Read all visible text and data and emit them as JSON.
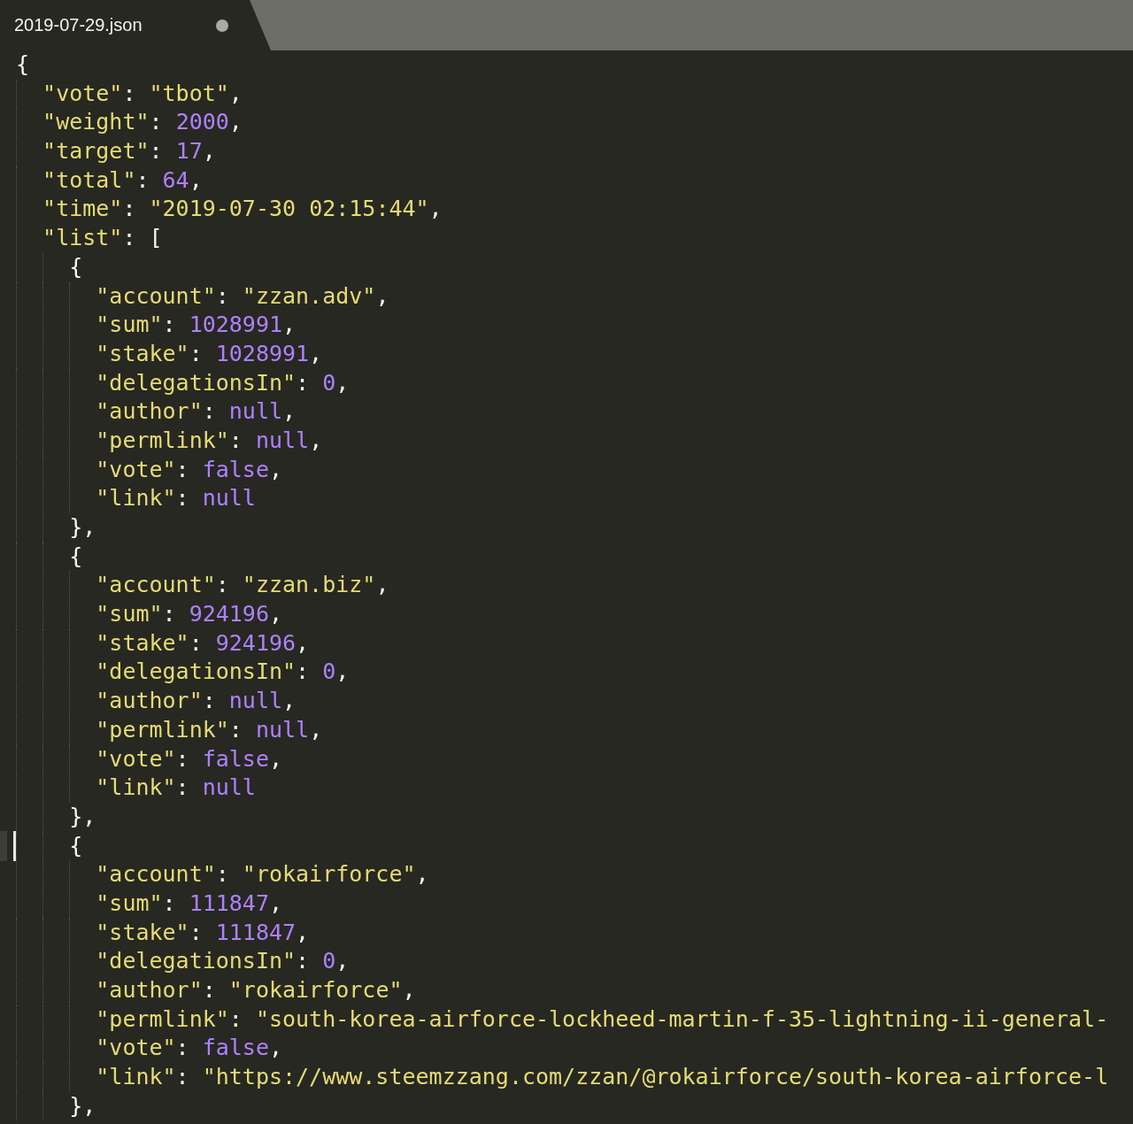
{
  "tab": {
    "title": "2019-07-29.json",
    "modified": true
  },
  "code": [
    {
      "tokens": [
        {
          "kind": "punct",
          "text": "{"
        }
      ],
      "children": [
        {
          "tokens": [
            {
              "kind": "key",
              "text": "\"vote\""
            },
            {
              "kind": "punct",
              "text": ": "
            },
            {
              "kind": "string",
              "text": "\"tbot\""
            },
            {
              "kind": "punct",
              "text": ","
            }
          ]
        },
        {
          "tokens": [
            {
              "kind": "key",
              "text": "\"weight\""
            },
            {
              "kind": "punct",
              "text": ": "
            },
            {
              "kind": "number",
              "text": "2000"
            },
            {
              "kind": "punct",
              "text": ","
            }
          ]
        },
        {
          "tokens": [
            {
              "kind": "key",
              "text": "\"target\""
            },
            {
              "kind": "punct",
              "text": ": "
            },
            {
              "kind": "number",
              "text": "17"
            },
            {
              "kind": "punct",
              "text": ","
            }
          ]
        },
        {
          "tokens": [
            {
              "kind": "key",
              "text": "\"total\""
            },
            {
              "kind": "punct",
              "text": ": "
            },
            {
              "kind": "number",
              "text": "64"
            },
            {
              "kind": "punct",
              "text": ","
            }
          ]
        },
        {
          "tokens": [
            {
              "kind": "key",
              "text": "\"time\""
            },
            {
              "kind": "punct",
              "text": ": "
            },
            {
              "kind": "string",
              "text": "\"2019-07-30 02:15:44\""
            },
            {
              "kind": "punct",
              "text": ","
            }
          ]
        },
        {
          "tokens": [
            {
              "kind": "key",
              "text": "\"list\""
            },
            {
              "kind": "punct",
              "text": ": ["
            }
          ],
          "children": [
            {
              "tokens": [
                {
                  "kind": "punct",
                  "text": "{"
                }
              ],
              "children": [
                {
                  "tokens": [
                    {
                      "kind": "key",
                      "text": "\"account\""
                    },
                    {
                      "kind": "punct",
                      "text": ": "
                    },
                    {
                      "kind": "string",
                      "text": "\"zzan.adv\""
                    },
                    {
                      "kind": "punct",
                      "text": ","
                    }
                  ]
                },
                {
                  "tokens": [
                    {
                      "kind": "key",
                      "text": "\"sum\""
                    },
                    {
                      "kind": "punct",
                      "text": ": "
                    },
                    {
                      "kind": "number",
                      "text": "1028991"
                    },
                    {
                      "kind": "punct",
                      "text": ","
                    }
                  ]
                },
                {
                  "tokens": [
                    {
                      "kind": "key",
                      "text": "\"stake\""
                    },
                    {
                      "kind": "punct",
                      "text": ": "
                    },
                    {
                      "kind": "number",
                      "text": "1028991"
                    },
                    {
                      "kind": "punct",
                      "text": ","
                    }
                  ]
                },
                {
                  "tokens": [
                    {
                      "kind": "key",
                      "text": "\"delegationsIn\""
                    },
                    {
                      "kind": "punct",
                      "text": ": "
                    },
                    {
                      "kind": "number",
                      "text": "0"
                    },
                    {
                      "kind": "punct",
                      "text": ","
                    }
                  ]
                },
                {
                  "tokens": [
                    {
                      "kind": "key",
                      "text": "\"author\""
                    },
                    {
                      "kind": "punct",
                      "text": ": "
                    },
                    {
                      "kind": "constant",
                      "text": "null"
                    },
                    {
                      "kind": "punct",
                      "text": ","
                    }
                  ]
                },
                {
                  "tokens": [
                    {
                      "kind": "key",
                      "text": "\"permlink\""
                    },
                    {
                      "kind": "punct",
                      "text": ": "
                    },
                    {
                      "kind": "constant",
                      "text": "null"
                    },
                    {
                      "kind": "punct",
                      "text": ","
                    }
                  ]
                },
                {
                  "tokens": [
                    {
                      "kind": "key",
                      "text": "\"vote\""
                    },
                    {
                      "kind": "punct",
                      "text": ": "
                    },
                    {
                      "kind": "constant",
                      "text": "false"
                    },
                    {
                      "kind": "punct",
                      "text": ","
                    }
                  ]
                },
                {
                  "tokens": [
                    {
                      "kind": "key",
                      "text": "\"link\""
                    },
                    {
                      "kind": "punct",
                      "text": ": "
                    },
                    {
                      "kind": "constant",
                      "text": "null"
                    }
                  ]
                }
              ]
            },
            {
              "tokens": [
                {
                  "kind": "punct",
                  "text": "},"
                }
              ]
            },
            {
              "tokens": [
                {
                  "kind": "punct",
                  "text": "{"
                }
              ],
              "children": [
                {
                  "tokens": [
                    {
                      "kind": "key",
                      "text": "\"account\""
                    },
                    {
                      "kind": "punct",
                      "text": ": "
                    },
                    {
                      "kind": "string",
                      "text": "\"zzan.biz\""
                    },
                    {
                      "kind": "punct",
                      "text": ","
                    }
                  ]
                },
                {
                  "tokens": [
                    {
                      "kind": "key",
                      "text": "\"sum\""
                    },
                    {
                      "kind": "punct",
                      "text": ": "
                    },
                    {
                      "kind": "number",
                      "text": "924196"
                    },
                    {
                      "kind": "punct",
                      "text": ","
                    }
                  ]
                },
                {
                  "tokens": [
                    {
                      "kind": "key",
                      "text": "\"stake\""
                    },
                    {
                      "kind": "punct",
                      "text": ": "
                    },
                    {
                      "kind": "number",
                      "text": "924196"
                    },
                    {
                      "kind": "punct",
                      "text": ","
                    }
                  ]
                },
                {
                  "tokens": [
                    {
                      "kind": "key",
                      "text": "\"delegationsIn\""
                    },
                    {
                      "kind": "punct",
                      "text": ": "
                    },
                    {
                      "kind": "number",
                      "text": "0"
                    },
                    {
                      "kind": "punct",
                      "text": ","
                    }
                  ]
                },
                {
                  "tokens": [
                    {
                      "kind": "key",
                      "text": "\"author\""
                    },
                    {
                      "kind": "punct",
                      "text": ": "
                    },
                    {
                      "kind": "constant",
                      "text": "null"
                    },
                    {
                      "kind": "punct",
                      "text": ","
                    }
                  ]
                },
                {
                  "tokens": [
                    {
                      "kind": "key",
                      "text": "\"permlink\""
                    },
                    {
                      "kind": "punct",
                      "text": ": "
                    },
                    {
                      "kind": "constant",
                      "text": "null"
                    },
                    {
                      "kind": "punct",
                      "text": ","
                    }
                  ]
                },
                {
                  "tokens": [
                    {
                      "kind": "key",
                      "text": "\"vote\""
                    },
                    {
                      "kind": "punct",
                      "text": ": "
                    },
                    {
                      "kind": "constant",
                      "text": "false"
                    },
                    {
                      "kind": "punct",
                      "text": ","
                    }
                  ]
                },
                {
                  "tokens": [
                    {
                      "kind": "key",
                      "text": "\"link\""
                    },
                    {
                      "kind": "punct",
                      "text": ": "
                    },
                    {
                      "kind": "constant",
                      "text": "null"
                    }
                  ]
                }
              ]
            },
            {
              "tokens": [
                {
                  "kind": "punct",
                  "text": "},"
                }
              ]
            },
            {
              "tokens": [
                {
                  "kind": "punct",
                  "text": "{"
                }
              ],
              "gutter_mark": true,
              "children": [
                {
                  "tokens": [
                    {
                      "kind": "key",
                      "text": "\"account\""
                    },
                    {
                      "kind": "punct",
                      "text": ": "
                    },
                    {
                      "kind": "string",
                      "text": "\"rokairforce\""
                    },
                    {
                      "kind": "punct",
                      "text": ","
                    }
                  ]
                },
                {
                  "tokens": [
                    {
                      "kind": "key",
                      "text": "\"sum\""
                    },
                    {
                      "kind": "punct",
                      "text": ": "
                    },
                    {
                      "kind": "number",
                      "text": "111847"
                    },
                    {
                      "kind": "punct",
                      "text": ","
                    }
                  ]
                },
                {
                  "tokens": [
                    {
                      "kind": "key",
                      "text": "\"stake\""
                    },
                    {
                      "kind": "punct",
                      "text": ": "
                    },
                    {
                      "kind": "number",
                      "text": "111847"
                    },
                    {
                      "kind": "punct",
                      "text": ","
                    }
                  ]
                },
                {
                  "tokens": [
                    {
                      "kind": "key",
                      "text": "\"delegationsIn\""
                    },
                    {
                      "kind": "punct",
                      "text": ": "
                    },
                    {
                      "kind": "number",
                      "text": "0"
                    },
                    {
                      "kind": "punct",
                      "text": ","
                    }
                  ]
                },
                {
                  "tokens": [
                    {
                      "kind": "key",
                      "text": "\"author\""
                    },
                    {
                      "kind": "punct",
                      "text": ": "
                    },
                    {
                      "kind": "string",
                      "text": "\"rokairforce\""
                    },
                    {
                      "kind": "punct",
                      "text": ","
                    }
                  ]
                },
                {
                  "tokens": [
                    {
                      "kind": "key",
                      "text": "\"permlink\""
                    },
                    {
                      "kind": "punct",
                      "text": ": "
                    },
                    {
                      "kind": "string",
                      "text": "\"south-korea-airforce-lockheed-martin-f-35-lightning-ii-general-"
                    }
                  ]
                },
                {
                  "tokens": [
                    {
                      "kind": "key",
                      "text": "\"vote\""
                    },
                    {
                      "kind": "punct",
                      "text": ": "
                    },
                    {
                      "kind": "constant",
                      "text": "false"
                    },
                    {
                      "kind": "punct",
                      "text": ","
                    }
                  ]
                },
                {
                  "tokens": [
                    {
                      "kind": "key",
                      "text": "\"link\""
                    },
                    {
                      "kind": "punct",
                      "text": ": "
                    },
                    {
                      "kind": "string",
                      "text": "\"https://www.steemzzang.com/zzan/@rokairforce/south-korea-airforce-l"
                    }
                  ]
                }
              ]
            },
            {
              "tokens": [
                {
                  "kind": "punct",
                  "text": "},"
                }
              ]
            }
          ]
        }
      ]
    }
  ]
}
